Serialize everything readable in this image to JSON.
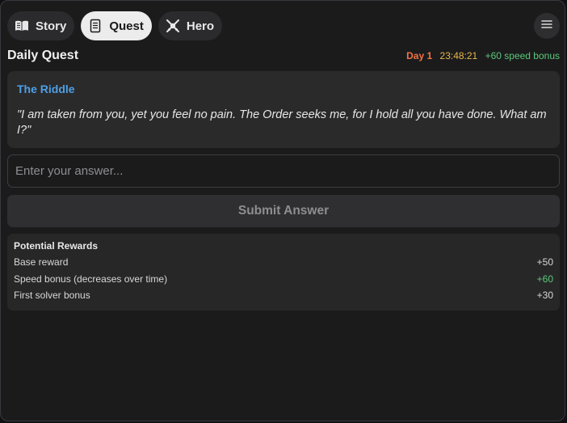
{
  "nav": {
    "tabs": [
      {
        "label": "Story",
        "icon": "book-icon"
      },
      {
        "label": "Quest",
        "icon": "scroll-icon",
        "active": true
      },
      {
        "label": "Hero",
        "icon": "crossed-swords-icon"
      }
    ],
    "menu_icon": "hamburger-menu-icon"
  },
  "header": {
    "title": "Daily Quest",
    "day": "Day 1",
    "timer": "23:48:21",
    "speed_bonus": "+60 speed bonus"
  },
  "riddle": {
    "title": "The Riddle",
    "text": "\"I am taken from you, yet you feel no pain. The Order seeks me, for I hold all you have done. What am I?\""
  },
  "answer": {
    "placeholder": "Enter your answer...",
    "value": ""
  },
  "submit": {
    "label": "Submit Answer"
  },
  "rewards": {
    "title": "Potential Rewards",
    "rows": [
      {
        "label": "Base reward",
        "value": "+50"
      },
      {
        "label": "Speed bonus (decreases over time)",
        "value": "+60"
      },
      {
        "label": "First solver bonus",
        "value": "+30"
      }
    ]
  },
  "colors": {
    "accent_blue": "#4f9fe6",
    "day_orange": "#f07444",
    "timer_yellow": "#e8b84a",
    "bonus_green": "#5cc879"
  }
}
